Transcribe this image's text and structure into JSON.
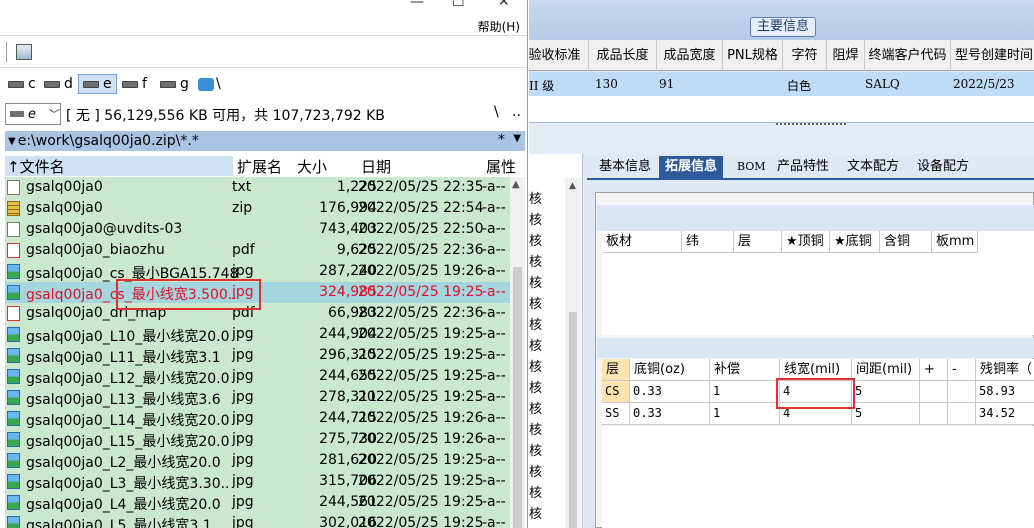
{
  "file_manager": {
    "help_menu": "帮助(H)",
    "drives": [
      {
        "letter": "c",
        "active": false
      },
      {
        "letter": "d",
        "active": false
      },
      {
        "letter": "e",
        "active": true
      },
      {
        "letter": "f",
        "active": false
      },
      {
        "letter": "g",
        "active": false
      },
      {
        "letter": "\\",
        "active": false
      }
    ],
    "drive_select": "e",
    "free_space": "[ 无 ]  56,129,556 KB 可用，共 107,723,792 KB",
    "nav_root": "\\",
    "nav_up": "..",
    "path": "e:\\work\\gsalq00ja0.zip\\*.*",
    "path_filter": "*",
    "columns": {
      "name": "↑文件名",
      "ext": "扩展名",
      "size": "大小",
      "date": "日期",
      "attr": "属性"
    },
    "files": [
      {
        "name": "gsalq00ja0",
        "ext": "txt",
        "size": "1,225",
        "date": "2022/05/25 22:35",
        "attr": "-a--",
        "icon": "text-file-icon"
      },
      {
        "name": "gsalq00ja0",
        "ext": "zip",
        "size": "176,994",
        "date": "2022/05/25 22:54",
        "attr": "-a--",
        "icon": "zip-file-icon"
      },
      {
        "name": "gsalq00ja0@uvdits-03",
        "ext": "",
        "size": "743,403",
        "date": "2022/05/25 22:50",
        "attr": "-a--",
        "icon": "text-file-icon"
      },
      {
        "name": "gsalq00ja0_biaozhu",
        "ext": "pdf",
        "size": "9,625",
        "date": "2022/05/25 22:36",
        "attr": "-a--",
        "icon": "pdf-file-icon"
      },
      {
        "name": "gsalq00ja0_cs_最小BGA15.748",
        "ext": "jpg",
        "size": "287,240",
        "date": "2022/05/25 19:26",
        "attr": "-a--",
        "icon": "image-file-icon"
      },
      {
        "name": "gsalq00ja0_cs_最小线宽3.500..",
        "ext": "jpg",
        "size": "324,985",
        "date": "2022/05/25 19:25",
        "attr": "-a--",
        "icon": "image-file-icon",
        "selected": true
      },
      {
        "name": "gsalq00ja0_drl_map",
        "ext": "pdf",
        "size": "66,983",
        "date": "2022/05/25 22:36",
        "attr": "-a--",
        "icon": "pdf-file-icon"
      },
      {
        "name": "gsalq00ja0_L10_最小线宽20.0",
        "ext": "jpg",
        "size": "244,904",
        "date": "2022/05/25 19:25",
        "attr": "-a--",
        "icon": "image-file-icon"
      },
      {
        "name": "gsalq00ja0_L11_最小线宽3.1",
        "ext": "jpg",
        "size": "296,315",
        "date": "2022/05/25 19:25",
        "attr": "-a--",
        "icon": "image-file-icon"
      },
      {
        "name": "gsalq00ja0_L12_最小线宽20.0",
        "ext": "jpg",
        "size": "244,655",
        "date": "2022/05/25 19:25",
        "attr": "-a--",
        "icon": "image-file-icon"
      },
      {
        "name": "gsalq00ja0_L13_最小线宽3.6",
        "ext": "jpg",
        "size": "278,311",
        "date": "2022/05/25 19:25",
        "attr": "-a--",
        "icon": "image-file-icon"
      },
      {
        "name": "gsalq00ja0_L14_最小线宽20.0",
        "ext": "jpg",
        "size": "244,715",
        "date": "2022/05/25 19:26",
        "attr": "-a--",
        "icon": "image-file-icon"
      },
      {
        "name": "gsalq00ja0_L15_最小线宽20.0",
        "ext": "jpg",
        "size": "275,730",
        "date": "2022/05/25 19:26",
        "attr": "-a--",
        "icon": "image-file-icon"
      },
      {
        "name": "gsalq00ja0_L2_最小线宽20.0",
        "ext": "jpg",
        "size": "281,620",
        "date": "2022/05/25 19:25",
        "attr": "-a--",
        "icon": "image-file-icon"
      },
      {
        "name": "gsalq00ja0_L3_最小线宽3.30..",
        "ext": "jpg",
        "size": "315,706",
        "date": "2022/05/25 19:25",
        "attr": "-a--",
        "icon": "image-file-icon"
      },
      {
        "name": "gsalq00ja0_L4_最小线宽20.0",
        "ext": "jpg",
        "size": "244,561",
        "date": "2022/05/25 19:25",
        "attr": "-a--",
        "icon": "image-file-icon"
      },
      {
        "name": "gsalq00ja0_L5_最小线宽3.1",
        "ext": "jpg",
        "size": "302,016",
        "date": "2022/05/25 19:25",
        "attr": "-a--",
        "icon": "image-file-icon"
      }
    ]
  },
  "erp": {
    "main_info_tab": "主要信息",
    "top_grid": {
      "headers": [
        "验收标准",
        "成品长度",
        "成品宽度",
        "PNL规格",
        "字符",
        "阻焊",
        "终端客户代码",
        "型号创建时间"
      ],
      "row": [
        "II 级",
        "130",
        "91",
        "",
        "白色",
        "",
        "SALQ",
        "2022/5/23"
      ]
    },
    "he_chars": [
      "核",
      "核",
      "核",
      "核",
      "核",
      "核",
      "核",
      "核",
      "核",
      "核",
      "核",
      "核",
      "核",
      "核",
      "核",
      "核",
      "核"
    ],
    "tabs": [
      "基本信息",
      "拓展信息",
      "BOM",
      "产品特性",
      "文本配方",
      "设备配方"
    ],
    "active_tab": "拓展信息",
    "board_headers": [
      "板材",
      "纬",
      "层",
      "★顶铜",
      "★底铜",
      "含铜",
      "板mm"
    ],
    "layer_headers": [
      "层",
      "底铜(oz)",
      "补偿",
      "线宽(mil)",
      "间距(mil)",
      "+",
      "-",
      "残铜率（"
    ],
    "layer_rows": [
      {
        "layer": "CS",
        "base_cu": "0.33",
        "comp": "1",
        "width": "4",
        "space": "5",
        "plus": "",
        "minus": "",
        "residual": "58.93"
      },
      {
        "layer": "SS",
        "base_cu": "0.33",
        "comp": "1",
        "width": "4",
        "space": "5",
        "plus": "",
        "minus": "",
        "residual": "34.52"
      }
    ],
    "highlight_color": "#e03030"
  }
}
